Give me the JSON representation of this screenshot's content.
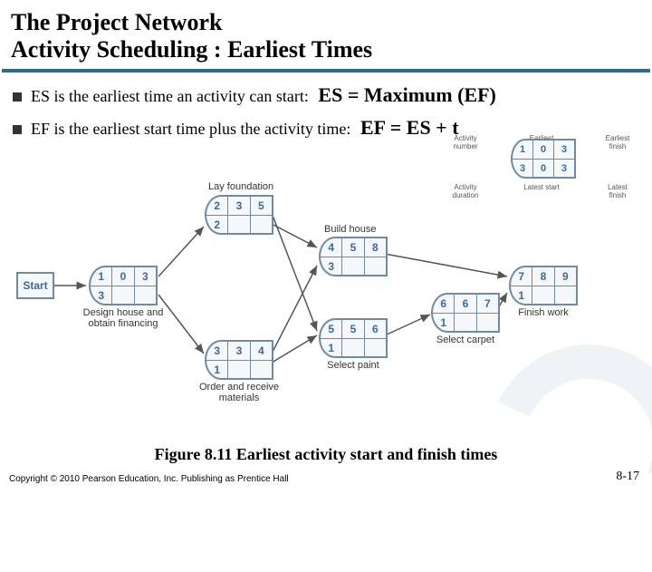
{
  "title_line1": "The Project Network",
  "title_line2": "Activity Scheduling : Earliest Times",
  "bullet1_text": "ES is the earliest time an activity can start:",
  "bullet1_formula": "ES = Maximum (EF)",
  "bullet2_text": "EF is the earliest start time plus the activity time:",
  "bullet2_formula": "EF = ES + t",
  "caption": "Figure 8.11   Earliest activity start and finish times",
  "copyright": "Copyright © 2010 Pearson Education, Inc. Publishing as Prentice Hall",
  "page": "8-17",
  "start_label": "Start",
  "legend": {
    "activity_number": "Activity number",
    "earliest_start": "Earliest start",
    "earliest_finish": "Earliest finish",
    "activity_duration": "Activity duration",
    "latest_start": "Latest start",
    "latest_finish": "Latest finish",
    "cells": [
      "1",
      "0",
      "3",
      "3",
      "0",
      "3"
    ]
  },
  "nodes": {
    "n1": {
      "top": [
        "1",
        "0",
        "3"
      ],
      "bottom": [
        "3",
        "",
        ""
      ],
      "label": "Design house and obtain financing"
    },
    "n2": {
      "top": [
        "2",
        "3",
        "5"
      ],
      "bottom": [
        "2",
        "",
        ""
      ],
      "label": "Lay foundation"
    },
    "n3": {
      "top": [
        "3",
        "3",
        "4"
      ],
      "bottom": [
        "1",
        "",
        ""
      ],
      "label": "Order and receive materials"
    },
    "n4": {
      "top": [
        "4",
        "5",
        "8"
      ],
      "bottom": [
        "3",
        "",
        ""
      ],
      "label": "Build house"
    },
    "n5": {
      "top": [
        "5",
        "5",
        "6"
      ],
      "bottom": [
        "1",
        "",
        ""
      ],
      "label": "Select paint"
    },
    "n6": {
      "top": [
        "6",
        "6",
        "7"
      ],
      "bottom": [
        "1",
        "",
        ""
      ],
      "label": "Select carpet"
    },
    "n7": {
      "top": [
        "7",
        "8",
        "9"
      ],
      "bottom": [
        "1",
        "",
        ""
      ],
      "label": "Finish work"
    }
  }
}
